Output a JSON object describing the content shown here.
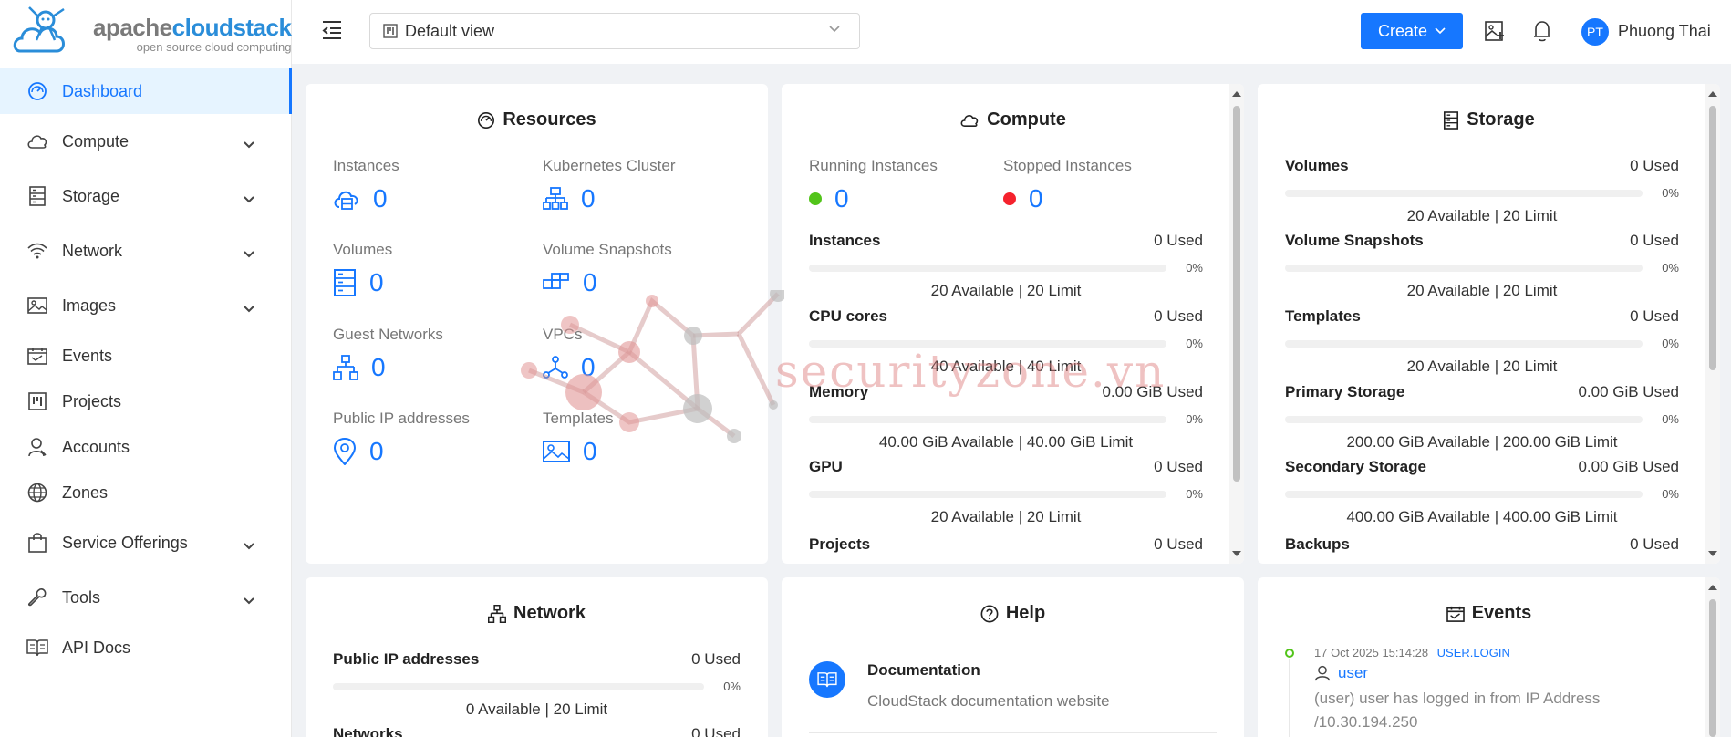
{
  "brand": {
    "apache": "apache",
    "cloudstack": "cloudstack",
    "tagline": "open source cloud computing"
  },
  "sidebar": {
    "items": [
      {
        "label": "Dashboard",
        "icon": "dashboard-icon",
        "active": true
      },
      {
        "label": "Compute",
        "icon": "cloud-icon",
        "expandable": true
      },
      {
        "label": "Storage",
        "icon": "storage-icon",
        "expandable": true
      },
      {
        "label": "Network",
        "icon": "wifi-icon",
        "expandable": true
      },
      {
        "label": "Images",
        "icon": "picture-icon",
        "expandable": true
      },
      {
        "label": "Events",
        "icon": "calendar-icon"
      },
      {
        "label": "Projects",
        "icon": "project-icon"
      },
      {
        "label": "Accounts",
        "icon": "user-icon"
      },
      {
        "label": "Zones",
        "icon": "globe-icon"
      },
      {
        "label": "Service Offerings",
        "icon": "shopping-icon",
        "expandable": true
      },
      {
        "label": "Tools",
        "icon": "tool-icon",
        "expandable": true
      },
      {
        "label": "API Docs",
        "icon": "read-icon"
      }
    ]
  },
  "header": {
    "view": "Default view",
    "create": "Create",
    "user_initials": "PT",
    "user_name": "Phuong Thai"
  },
  "resources": {
    "title": "Resources",
    "stats": [
      {
        "label": "Instances",
        "value": "0",
        "icon": "cloud-server-icon"
      },
      {
        "label": "Kubernetes Cluster",
        "value": "0",
        "icon": "cluster-icon"
      },
      {
        "label": "Volumes",
        "value": "0",
        "icon": "volume-icon"
      },
      {
        "label": "Volume Snapshots",
        "value": "0",
        "icon": "snapshot-icon"
      },
      {
        "label": "Guest Networks",
        "value": "0",
        "icon": "network-icon"
      },
      {
        "label": "VPCs",
        "value": "0",
        "icon": "vpc-icon"
      },
      {
        "label": "Public IP addresses",
        "value": "0",
        "icon": "location-icon"
      },
      {
        "label": "Templates",
        "value": "0",
        "icon": "picture-icon"
      }
    ]
  },
  "compute": {
    "title": "Compute",
    "running_label": "Running Instances",
    "running_value": "0",
    "running_color": "#52c41a",
    "stopped_label": "Stopped Instances",
    "stopped_value": "0",
    "stopped_color": "#f5222d",
    "rows": [
      {
        "name": "Instances",
        "used": "0 Used",
        "pct": "0%",
        "fill": 0,
        "avail": "20 Available | 20 Limit"
      },
      {
        "name": "CPU cores",
        "used": "0 Used",
        "pct": "0%",
        "fill": 0,
        "avail": "40 Available | 40 Limit"
      },
      {
        "name": "Memory",
        "used": "0.00 GiB Used",
        "pct": "0%",
        "fill": 0,
        "avail": "40.00 GiB Available | 40.00 GiB Limit"
      },
      {
        "name": "GPU",
        "used": "0 Used",
        "pct": "0%",
        "fill": 0,
        "avail": "20 Available | 20 Limit"
      },
      {
        "name": "Projects",
        "used": "0 Used"
      }
    ]
  },
  "storage": {
    "title": "Storage",
    "rows": [
      {
        "name": "Volumes",
        "used": "0 Used",
        "pct": "0%",
        "fill": 0,
        "avail": "20 Available | 20 Limit"
      },
      {
        "name": "Volume Snapshots",
        "used": "0 Used",
        "pct": "0%",
        "fill": 0,
        "avail": "20 Available | 20 Limit"
      },
      {
        "name": "Templates",
        "used": "0 Used",
        "pct": "0%",
        "fill": 0,
        "avail": "20 Available | 20 Limit"
      },
      {
        "name": "Primary Storage",
        "used": "0.00 GiB Used",
        "pct": "0%",
        "fill": 0,
        "avail": "200.00 GiB Available | 200.00 GiB Limit"
      },
      {
        "name": "Secondary Storage",
        "used": "0.00 GiB Used",
        "pct": "0%",
        "fill": 0,
        "avail": "400.00 GiB Available | 400.00 GiB Limit"
      },
      {
        "name": "Backups",
        "used": "0 Used"
      }
    ]
  },
  "network": {
    "title": "Network",
    "rows": [
      {
        "name": "Public IP addresses",
        "used": "0 Used",
        "pct": "0%",
        "fill": 0,
        "avail": "0 Available | 20 Limit"
      },
      {
        "name": "Networks",
        "used": "0 Used"
      }
    ]
  },
  "help": {
    "title": "Help",
    "doc_title": "Documentation",
    "doc_desc": "CloudStack documentation website"
  },
  "events": {
    "title": "Events",
    "items": [
      {
        "time": "17 Oct 2025 15:14:28",
        "type": "USER.LOGIN",
        "user": "user",
        "desc1": "(user) user has logged in from IP Address",
        "desc2": "/10.30.194.250"
      }
    ]
  },
  "watermark": "securityzone.vn"
}
